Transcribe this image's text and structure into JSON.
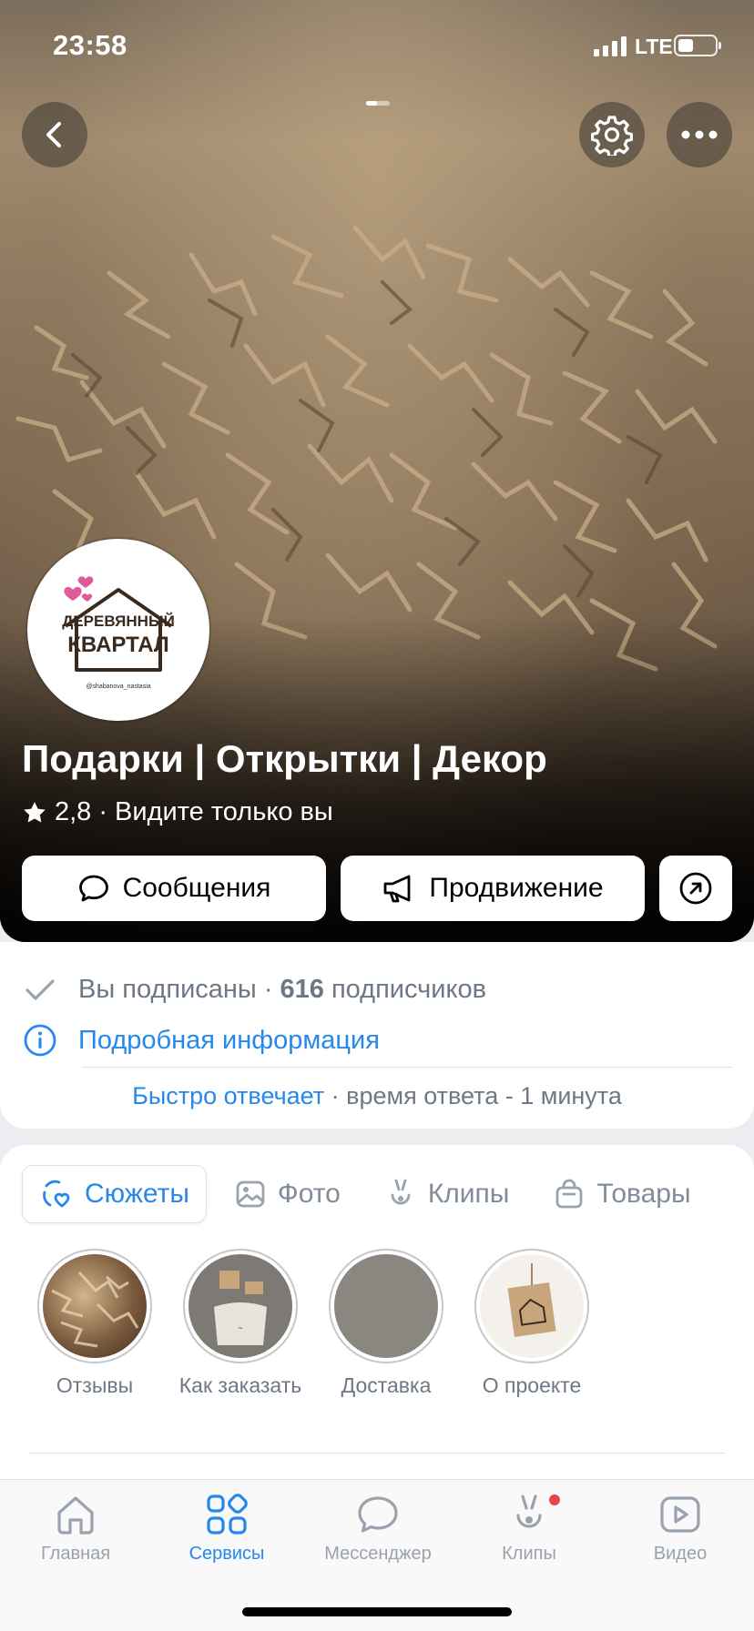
{
  "status_bar": {
    "time": "23:58",
    "network": "LTE"
  },
  "header": {
    "back_icon": "chevron-left-icon",
    "settings_icon": "gear-icon",
    "more_icon": "ellipsis-icon"
  },
  "community": {
    "logo_text_line1": "ДЕРЕВЯННЫЙ",
    "logo_text_line2": "КВАРТАЛ",
    "logo_handle": "@shabanova_nastasia",
    "name": "Подарки | Открытки | Декор",
    "rating": "2,8",
    "visibility": "· Видите только вы"
  },
  "actions": {
    "messages": "Сообщения",
    "promotion": "Продвижение",
    "share_icon": "arrow-up-right-icon"
  },
  "info": {
    "subscribed": "Вы подписаны · ",
    "subscribers_count": "616",
    "subscribers_label": " подписчиков",
    "details": "Подробная информация",
    "fast_reply": "Быстро отвечает",
    "response_time": " · время ответа - 1 минута"
  },
  "tabs": [
    {
      "label": "Сюжеты",
      "icon": "heart-stories-icon",
      "active": true
    },
    {
      "label": "Фото",
      "icon": "image-icon",
      "active": false
    },
    {
      "label": "Клипы",
      "icon": "clips-icon",
      "active": false
    },
    {
      "label": "Товары",
      "icon": "bag-icon",
      "active": false
    }
  ],
  "stories": [
    {
      "label": "Отзывы"
    },
    {
      "label": "Как заказать"
    },
    {
      "label": "Доставка"
    },
    {
      "label": "О проекте"
    }
  ],
  "tabbar": [
    {
      "label": "Главная",
      "icon": "home-icon",
      "active": false
    },
    {
      "label": "Сервисы",
      "icon": "services-icon",
      "active": true
    },
    {
      "label": "Мессенджер",
      "icon": "messenger-icon",
      "active": false
    },
    {
      "label": "Клипы",
      "icon": "clips-icon",
      "active": false,
      "badge": true
    },
    {
      "label": "Видео",
      "icon": "video-icon",
      "active": false
    }
  ],
  "colors": {
    "accent": "#2688eb",
    "secondary_text": "#818c99",
    "badge": "#e64646"
  }
}
